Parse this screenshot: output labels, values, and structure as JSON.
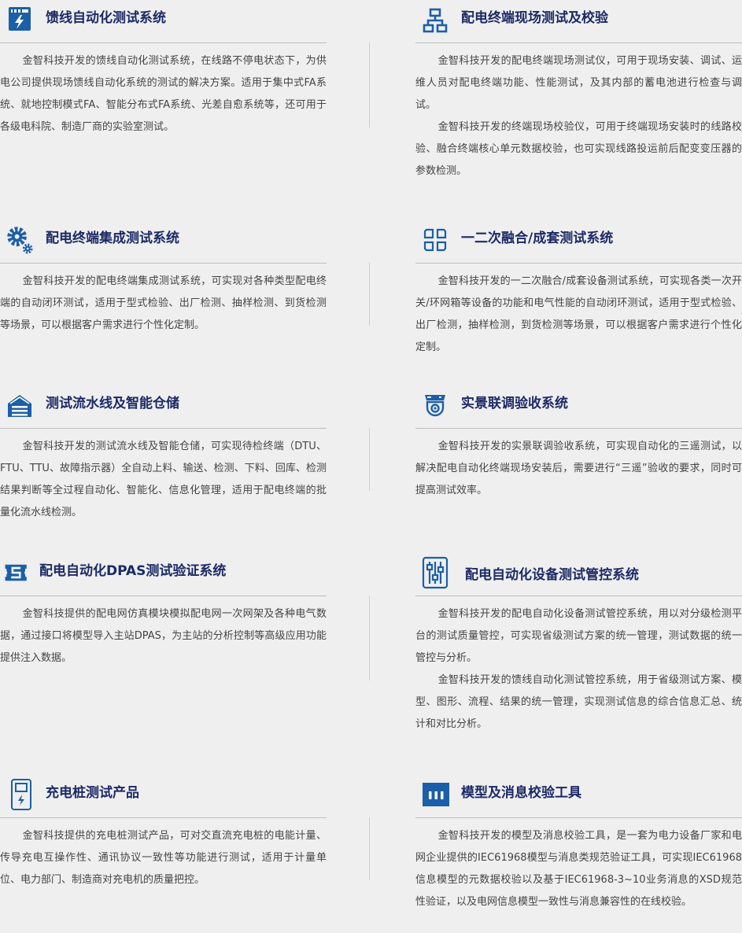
{
  "cards": [
    {
      "title": "馈线自动化测试系统",
      "icon": "power-panel-icon",
      "paras": [
        "金智科技开发的馈线自动化测试系统，在线路不停电状态下，为供电公司提供现场馈线自动化系统的测试的解决方案。适用于集中式FA系统、就地控制模式FA、智能分布式FA系统、光差自愈系统等，还可用于各级电科院、制造厂商的实验室测试。"
      ]
    },
    {
      "title": "配电终端现场测试及校验",
      "icon": "network-icon",
      "paras": [
        "金智科技开发的配电终端现场测试仪，可用于现场安装、调试、运维人员对配电终端功能、性能测试，及其内部的蓄电池进行检查与调试。",
        "金智科技开发的终端现场校验仪，可用于终端现场安装时的线路校验、融合终端核心单元数据校验，也可实现线路投运前后配变变压器的参数检测。"
      ]
    },
    {
      "title": "配电终端集成测试系统",
      "icon": "gears-icon",
      "paras": [
        "金智科技开发的配电终端集成测试系统，可实现对各种类型配电终端的自动闭环测试，适用于型式检验、出厂检测、抽样检测、到货检测等场景，可以根据客户需求进行个性化定制。"
      ]
    },
    {
      "title": "一二次融合/成套测试系统",
      "icon": "grid-blocks-icon",
      "paras": [
        "金智科技开发的一二次融合/成套设备测试系统，可实现各类一次开关/环网箱等设备的功能和电气性能的自动闭环测试，适用于型式检验、出厂检测，抽样检测，到货检测等场景，可以根据客户需求进行个性化定制。"
      ]
    },
    {
      "title": "测试流水线及智能仓储",
      "icon": "warehouse-icon",
      "paras": [
        "金智科技开发的测试流水线及智能仓储，可实现待检终端（DTU、FTU、TTU、故障指示器）全自动上料、输送、检测、下料、回库、检测结果判断等全过程自动化、智能化、信息化管理，适用于配电终端的批量化流水线检测。"
      ]
    },
    {
      "title": "实景联调验收系统",
      "icon": "camera-icon",
      "paras": [
        "金智科技开发的实景联调验收系统，可实现自动化的三遥测试，以解决配电自动化终端现场安装后，需要进行“三遥”验收的要求，同时可提高测试效率。"
      ]
    },
    {
      "title": "配电自动化DPAS测试验证系统",
      "icon": "server-icon",
      "paras": [
        "金智科技提供的配电网仿真模块模拟配电网一次网架及各种电气数据，通过接口将模型导入主站DPAS，为主站的分析控制等高级应用功能提供注入数据。"
      ]
    },
    {
      "title": "配电自动化设备测试管控系统",
      "icon": "sliders-icon",
      "paras": [
        "金智科技开发的配电自动化设备测试管控系统，用以对分级检测平台的测试质量管控，可实现省级测试方案的统一管理，测试数据的统一管控与分析。",
        "金智科技开发的馈线自动化测试管控系统，用于省级测试方案、模型、图形、流程、结果的统一管理，实现测试信息的综合信息汇总、统计和对比分析。"
      ]
    },
    {
      "title": "充电桩测试产品",
      "icon": "charging-pile-icon",
      "paras": [
        "金智科技提供的充电桩测试产品，可对交直流充电桩的电能计量、传导充电互操作性、通讯协议一致性等功能进行测试，适用于计量单位、电力部门、制造商对充电机的质量把控。"
      ]
    },
    {
      "title": "模型及消息校验工具",
      "icon": "bars-icon",
      "paras": [
        "金智科技开发的模型及消息校验工具，是一套为电力设备厂家和电网企业提供的IEC61968模型与消息类规范验证工具，可实现IEC61968信息模型的元数据校验以及基于IEC61968-3~10业务消息的XSD规范性验证，以及电网信息模型一致性与消息兼容性的在线校验。"
      ]
    }
  ]
}
